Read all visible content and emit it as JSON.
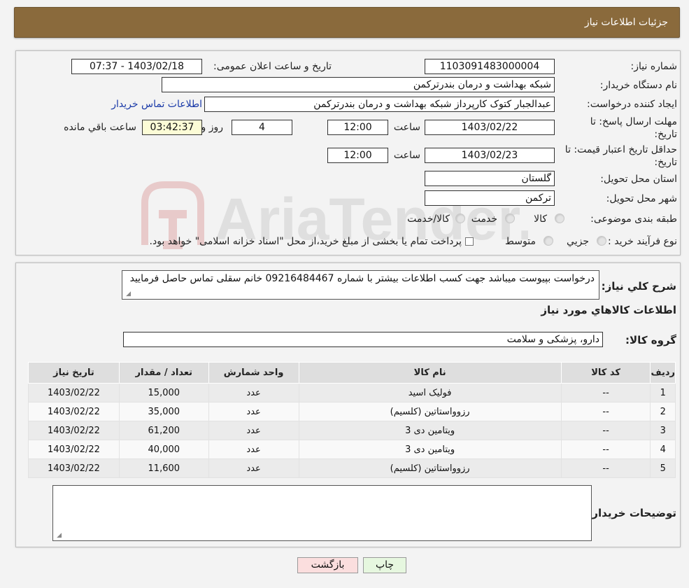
{
  "header": {
    "title": "جزئیات اطلاعات نیاز"
  },
  "form": {
    "need_number_label": "شماره نیاز:",
    "need_number": "1103091483000004",
    "announce_label": "تاریخ و ساعت اعلان عمومی:",
    "announce_value": "1403/02/18 - 07:37",
    "buyer_org_label": "نام دستگاه خریدار:",
    "buyer_org": "شبکه بهداشت و درمان بندرترکمن",
    "creator_label": "ایجاد کننده درخواست:",
    "creator": "عبدالجبار کتوک کارپرداز شبکه بهداشت و درمان بندرترکمن",
    "contact_link": "اطلاعات تماس خریدار",
    "deadline_label_1": "مهلت ارسال پاسخ: تا",
    "deadline_label_2": "تاریخ:",
    "deadline_date": "1403/02/22",
    "time_label": "ساعت",
    "deadline_time": "12:00",
    "days_value": "4",
    "days_label": "روز و",
    "remaining_time": "03:42:37",
    "remaining_label": "ساعت باقي مانده",
    "validity_label_1": "حداقل تاریخ اعتبار قیمت: تا",
    "validity_label_2": "تاریخ:",
    "validity_date": "1403/02/23",
    "validity_time": "12:00",
    "province_label": "استان محل تحویل:",
    "province": "گلستان",
    "city_label": "شهر محل تحویل:",
    "city": "ترکمن",
    "category_label": "طبقه بندی موضوعی:",
    "category_options": [
      "کالا",
      "خدمت",
      "کالا/خدمت"
    ],
    "process_label": "نوع فرآیند خرید :",
    "process_options": [
      "جزیي",
      "متوسط"
    ],
    "process_note": "پرداخت تمام یا بخشی از مبلغ خرید،از محل \"اسناد خزانه اسلامی\" خواهد بود."
  },
  "details": {
    "description_label": "شرح کلي نياز:",
    "description": "درخواست بپیوست میباشد جهت کسب اطلاعات بیشتر با شماره 09216484467 خانم سقلی تماس حاصل فرمایید",
    "goods_title": "اطلاعات کالاهاي مورد نياز",
    "group_label": "گروه کالا:",
    "group_value": "دارو، پزشکی و سلامت"
  },
  "table": {
    "headers": [
      "رديف",
      "کد کالا",
      "نام کالا",
      "واحد شمارش",
      "تعداد / مقدار",
      "تاريخ نياز"
    ],
    "rows": [
      [
        "1",
        "--",
        "فولیک اسید",
        "عدد",
        "15,000",
        "1403/02/22"
      ],
      [
        "2",
        "--",
        "رزوواستاتین (کلسیم)",
        "عدد",
        "35,000",
        "1403/02/22"
      ],
      [
        "3",
        "--",
        "ویتامین دی 3",
        "عدد",
        "61,200",
        "1403/02/22"
      ],
      [
        "4",
        "--",
        "ویتامین دی 3",
        "عدد",
        "40,000",
        "1403/02/22"
      ],
      [
        "5",
        "--",
        "رزوواستاتین (کلسیم)",
        "عدد",
        "11,600",
        "1403/02/22"
      ]
    ]
  },
  "notes": {
    "label": "توضیحات خریدار:",
    "value": ""
  },
  "buttons": {
    "print": "چاپ",
    "back": "بازگشت"
  },
  "watermark": {
    "text": "AriaTender.neT"
  },
  "colors": {
    "header_bg": "#8a6a3c",
    "link": "#1a3aa8",
    "print_btn": "#e6f7df",
    "back_btn": "#fbdede"
  }
}
